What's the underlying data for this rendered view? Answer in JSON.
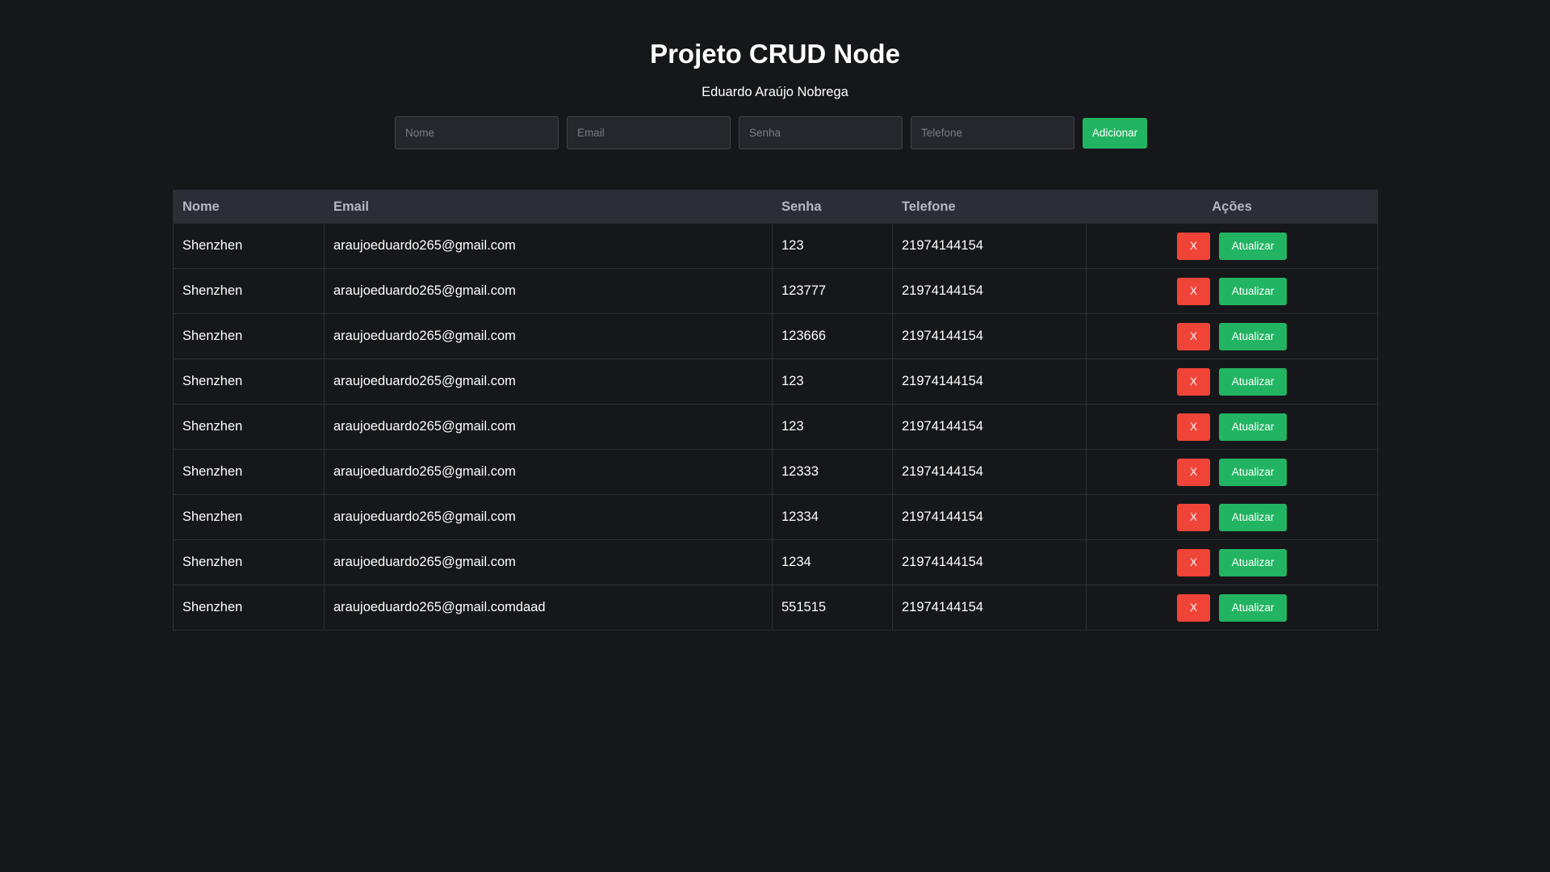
{
  "header": {
    "title": "Projeto CRUD Node",
    "subtitle": "Eduardo Araújo Nobrega"
  },
  "form": {
    "name_placeholder": "Nome",
    "email_placeholder": "Email",
    "password_placeholder": "Senha",
    "phone_placeholder": "Telefone",
    "name_value": "",
    "email_value": "",
    "password_value": "",
    "phone_value": "",
    "add_label": "Adicionar"
  },
  "table": {
    "columns": [
      "Nome",
      "Email",
      "Senha",
      "Telefone",
      "Ações"
    ],
    "delete_label": "X",
    "update_label": "Atualizar",
    "rows": [
      {
        "nome": "Shenzhen",
        "email": "araujoeduardo265@gmail.com",
        "senha": "123",
        "telefone": "21974144154"
      },
      {
        "nome": "Shenzhen",
        "email": "araujoeduardo265@gmail.com",
        "senha": "123777",
        "telefone": "21974144154"
      },
      {
        "nome": "Shenzhen",
        "email": "araujoeduardo265@gmail.com",
        "senha": "123666",
        "telefone": "21974144154"
      },
      {
        "nome": "Shenzhen",
        "email": "araujoeduardo265@gmail.com",
        "senha": "123",
        "telefone": "21974144154"
      },
      {
        "nome": "Shenzhen",
        "email": "araujoeduardo265@gmail.com",
        "senha": "123",
        "telefone": "21974144154"
      },
      {
        "nome": "Shenzhen",
        "email": "araujoeduardo265@gmail.com",
        "senha": "12333",
        "telefone": "21974144154"
      },
      {
        "nome": "Shenzhen",
        "email": "araujoeduardo265@gmail.com",
        "senha": "12334",
        "telefone": "21974144154"
      },
      {
        "nome": "Shenzhen",
        "email": "araujoeduardo265@gmail.com",
        "senha": "1234",
        "telefone": "21974144154"
      },
      {
        "nome": "Shenzhen",
        "email": "araujoeduardo265@gmail.comdaad",
        "senha": "551515",
        "telefone": "21974144154"
      }
    ]
  },
  "colors": {
    "background": "#16171b",
    "header_row": "#2b2e35",
    "accent_green": "#22b462",
    "danger_red": "#f04438"
  }
}
